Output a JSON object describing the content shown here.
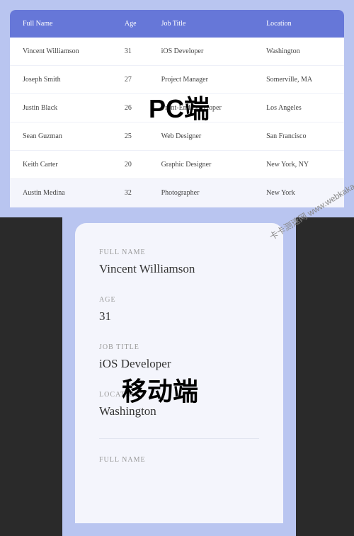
{
  "desktop": {
    "headers": [
      "Full Name",
      "Age",
      "Job Title",
      "Location"
    ],
    "rows": [
      {
        "name": "Vincent Williamson",
        "age": "31",
        "title": "iOS Developer",
        "location": "Washington"
      },
      {
        "name": "Joseph Smith",
        "age": "27",
        "title": "Project Manager",
        "location": "Somerville, MA"
      },
      {
        "name": "Justin Black",
        "age": "26",
        "title": "Front-End Developer",
        "location": "Los Angeles"
      },
      {
        "name": "Sean Guzman",
        "age": "25",
        "title": "Web Designer",
        "location": "San Francisco"
      },
      {
        "name": "Keith Carter",
        "age": "20",
        "title": "Graphic Designer",
        "location": "New York, NY"
      },
      {
        "name": "Austin Medina",
        "age": "32",
        "title": "Photographer",
        "location": "New York"
      }
    ]
  },
  "mobile": {
    "labels": {
      "name": "FULL NAME",
      "age": "AGE",
      "title": "JOB TITLE",
      "location": "LOCATION"
    },
    "record": {
      "name": "Vincent Williamson",
      "age": "31",
      "title": "iOS Developer",
      "location": "Washington"
    },
    "next_label": "FULL NAME"
  },
  "overlays": {
    "pc": "PC端",
    "mobile": "移动端"
  },
  "watermark": "卡卡测速网 www.webkaka.com"
}
